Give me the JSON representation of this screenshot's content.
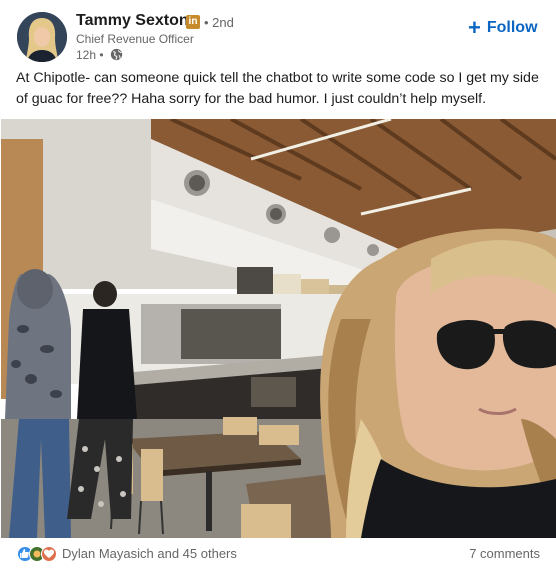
{
  "author": {
    "name": "Tammy Sexton",
    "badge": "in",
    "degree": "• 2nd",
    "headline": "Chief Revenue Officer",
    "time": "12h •"
  },
  "follow": {
    "label": "Follow"
  },
  "post": {
    "text": "At Chipotle- can someone quick tell the chatbot to write some code so I get my side of guac for free?? Haha sorry for the bad humor. I just couldn’t help myself."
  },
  "social": {
    "reactions_text": "Dylan Mayasich and 45 others",
    "comments_text": "7 comments"
  },
  "colors": {
    "accent": "#0a66c2",
    "secondary_text": "#666666",
    "badge": "#c68a2a"
  }
}
